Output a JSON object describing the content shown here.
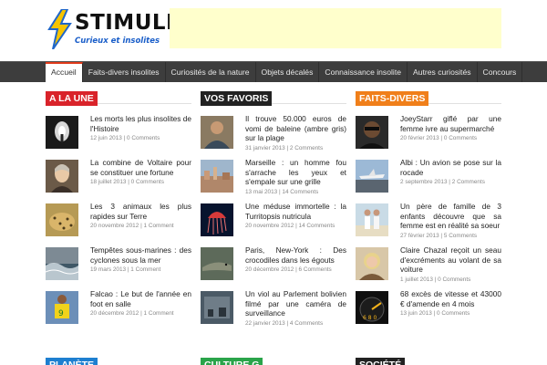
{
  "brand": {
    "title": "STIMULI",
    "tagline": "Curieux et insolites",
    "accent": "#e03a1a",
    "tagline_color": "#1a5ec9"
  },
  "nav": {
    "items": [
      {
        "label": "Accueil",
        "active": true
      },
      {
        "label": "Faits-divers insolites"
      },
      {
        "label": "Curiosités de la nature"
      },
      {
        "label": "Objets décalés"
      },
      {
        "label": "Connaissance insolite"
      },
      {
        "label": "Autres curiosités"
      },
      {
        "label": "Concours"
      }
    ]
  },
  "columns": [
    {
      "heading": "A LA UNE",
      "color": "#d9232a",
      "posts": [
        {
          "title": "Les morts les plus insolites de l'Histoire",
          "date": "12 juin 2013",
          "comments": "0 Comments",
          "thumb": "tunnel"
        },
        {
          "title": "La combine de Voltaire pour se constituer une fortune",
          "date": "18 juillet 2013",
          "comments": "0 Comments",
          "thumb": "portrait"
        },
        {
          "title": "Les 3 animaux les plus rapides sur Terre",
          "date": "20 novembre 2012",
          "comments": "1 Comment",
          "thumb": "cheetah"
        },
        {
          "title": "Tempêtes sous-marines : des cyclones sous la mer",
          "date": "19 mars 2013",
          "comments": "1 Comment",
          "thumb": "ocean"
        },
        {
          "title": "Falcao : Le but de l'année en foot en salle",
          "date": "20 décembre 2012",
          "comments": "1 Comment",
          "thumb": "football"
        }
      ]
    },
    {
      "heading": "VOS FAVORIS",
      "color": "#222222",
      "posts": [
        {
          "title": "Il trouve 50.000 euros de vomi de baleine (ambre gris) sur la plage",
          "date": "31 janvier 2013",
          "comments": "2 Comments",
          "thumb": "man"
        },
        {
          "title": "Marseille : un homme fou s'arrache les yeux et s'empale sur une grille",
          "date": "13 mai 2013",
          "comments": "14 Comments",
          "thumb": "city"
        },
        {
          "title": "Une méduse immortelle : la Turritopsis nutricula",
          "date": "20 novembre 2012",
          "comments": "14 Comments",
          "thumb": "jellyfish"
        },
        {
          "title": "Paris, New-York : Des crocodiles dans les égouts",
          "date": "20 décembre 2012",
          "comments": "6 Comments",
          "thumb": "croco"
        },
        {
          "title": "Un viol au Parlement bolivien filmé par une caméra de surveillance",
          "date": "22 janvier 2013",
          "comments": "4 Comments",
          "thumb": "parliament"
        }
      ]
    },
    {
      "heading": "FAITS-DIVERS",
      "color": "#f07f1a",
      "posts": [
        {
          "title": "JoeyStarr giflé par une femme ivre au supermarché",
          "date": "20 février 2013",
          "comments": "0 Comments",
          "thumb": "joey"
        },
        {
          "title": "Albi : Un avion se pose sur la rocade",
          "date": "2 septembre 2013",
          "comments": "2 Comments",
          "thumb": "plane"
        },
        {
          "title": "Un père de famille de 3 enfants découvre que sa femme est en réalité sa soeur",
          "date": "27 février 2013",
          "comments": "5 Comments",
          "thumb": "couple"
        },
        {
          "title": "Claire Chazal reçoit un seau d'excréments au volant de sa voiture",
          "date": "1 juillet 2013",
          "comments": "0 Comments",
          "thumb": "blonde"
        },
        {
          "title": "68 excès de vitesse et 43000 € d'amende en 4 mois",
          "date": "13 juin 2013",
          "comments": "0 Comments",
          "thumb": "speedo"
        }
      ]
    }
  ],
  "bottom_headings": [
    {
      "heading": "PLANÈTE",
      "color": "#1e7fd0"
    },
    {
      "heading": "CULTURE G",
      "color": "#2aa44a"
    },
    {
      "heading": "SOCIÉTÉ",
      "color": "#222222"
    }
  ]
}
